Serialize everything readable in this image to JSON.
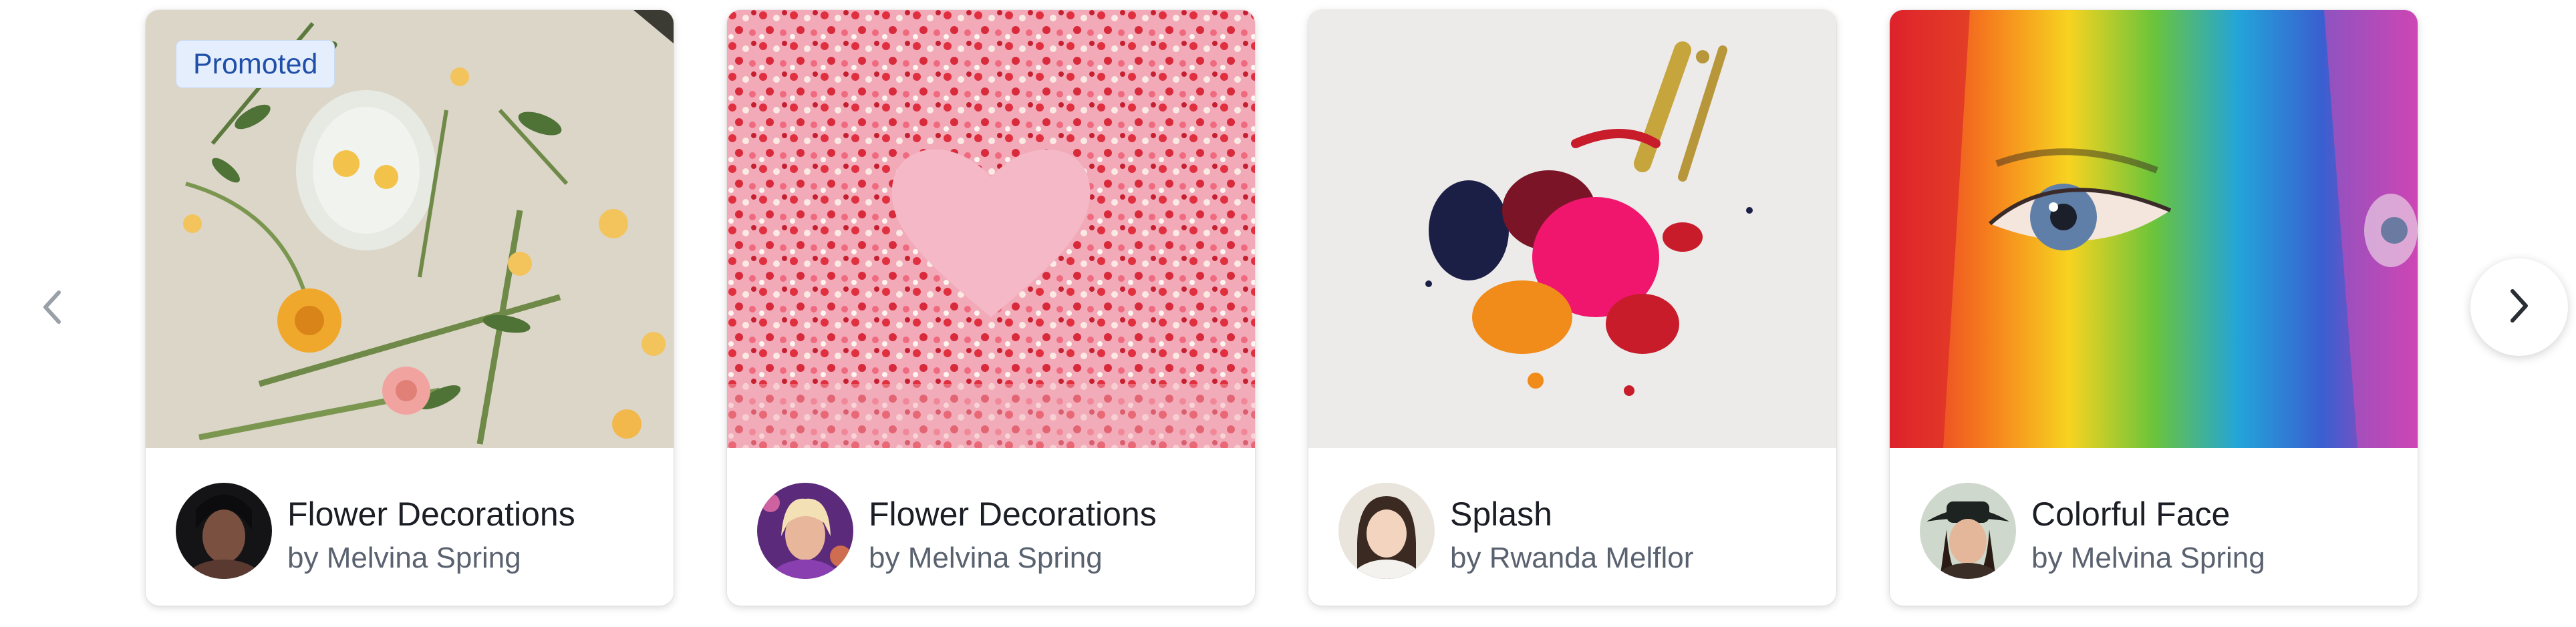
{
  "carousel": {
    "prev_icon": "chevron-left-icon",
    "next_icon": "chevron-right-icon",
    "cards": [
      {
        "title": "Flower Decorations",
        "author": "by Melvina Spring",
        "badge": "Promoted"
      },
      {
        "title": "Flower Decorations",
        "author": "by Melvina Spring"
      },
      {
        "title": "Splash",
        "author": "by Rwanda Melflor"
      },
      {
        "title": "Colorful Face",
        "author": "by Melvina Spring"
      }
    ]
  },
  "colors": {
    "title": "#1b1e24",
    "author": "#5a6270",
    "badge_bg": "#e4eefc",
    "badge_text": "#1f4fa8"
  }
}
